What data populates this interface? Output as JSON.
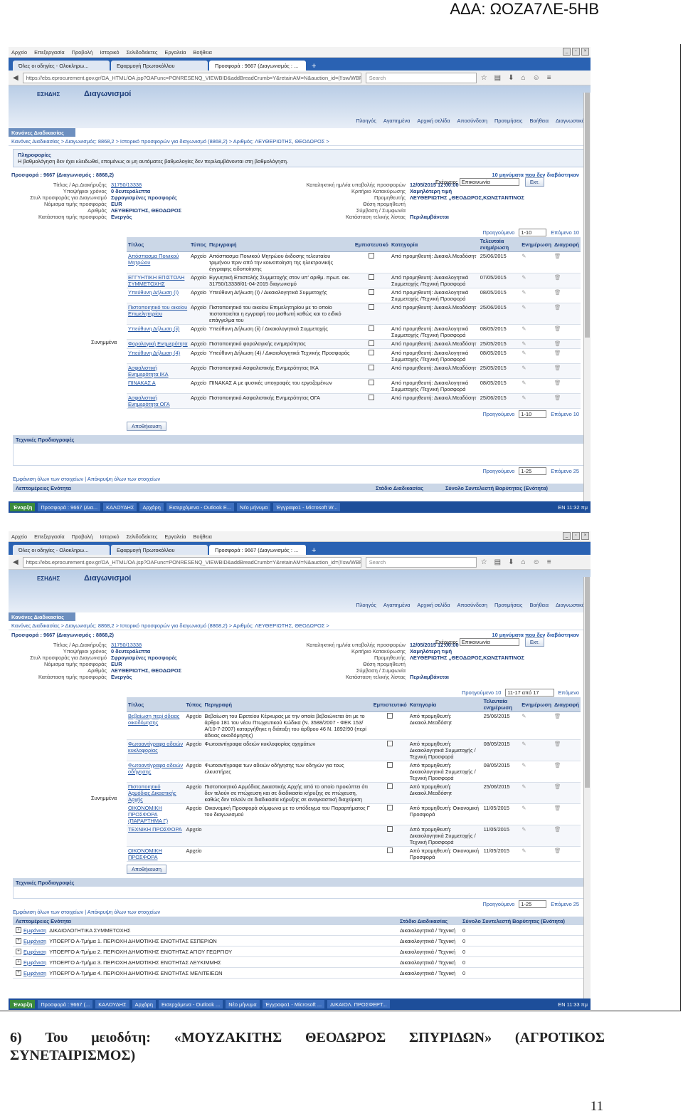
{
  "ada": "ΑΔΑ: ΩΟΖΑ7ΛΕ-5ΗΒ",
  "browser": {
    "menu": [
      "Αρχείο",
      "Επεξεργασία",
      "Προβολή",
      "Ιστορικό",
      "Σελιδοδείκτες",
      "Εργαλεία",
      "Βοήθεια"
    ],
    "tabs": [
      "Όλες οι οδηγίες - Ολοκληρω...",
      "Εφαρμογή Πρωτοκόλλου",
      "Προσφορά : 9667 (Διαγωνισμός : ..."
    ],
    "url": "https://ebs.eprocurement.gov.gr/OA_HTML/OA.jsp?OAFunc=PONRESENQ_VIEWBID&addBreadCrumb=Y&retainAM=N&auction_id=(!!sw/WBR0gKB",
    "search_placeholder": "Search"
  },
  "app": {
    "logo": "ΕΣΗΔΗΣ",
    "title": "Διαγωνισμοί",
    "menu": [
      "Πλοηγός",
      "Αγαπημένα",
      "Αρχική σελίδα",
      "Αποσύνδεση",
      "Προτιμήσεις",
      "Βοήθεια",
      "Διαγνωστικά"
    ],
    "tab_label": "Κανόνες Διαδικασίας",
    "breadcrumbs1": "Κανόνες Διαδικασίας > Διαγωνισμός: 8868,2 > Ιστορικό προσφορών για διαγωνισμό (8868,2) > Αριθμός: ΛΕΥΘΕΡΙΩΤΗΣ, ΘΕΟΔΩΡΟΣ >",
    "info_title": "Πληροφορίες",
    "info_text": "Η βαθμολόγηση δεν έχει κλειδωθεί, επομένως οι μη αυτόματες βαθμολογίες δεν περιλαμβάνονται στη βαθμολόγηση.",
    "offer_title": "Προσφορά : 9667 (Διαγωνισμός : 8868,2)",
    "unread": "10 μηνύματα που δεν διαβάστηκαν",
    "actions_label": "Ενέργειες",
    "actions_value": "Επικοινωνία",
    "go": "Εκτ.",
    "summary_left_labels": [
      "Τίτλος / Αρ.Διακήρυξης",
      "Υποψήφιοι χρόνος",
      "Στυλ προσφοράς για Διαγωνισμό",
      "Νόμισμα τιμής προσφοράς",
      "Αριθμός",
      "Κατάσταση τιμής προσφοράς"
    ],
    "summary_left_values1": [
      "31750/13338",
      "0 δευτερόλεπτα",
      "Σφραγισμένες προσφορές",
      "EUR",
      "ΛΕΥΘΕΡΙΩΤΗΣ, ΘΕΟΔΩΡΟΣ",
      "Ενεργός"
    ],
    "summary_right_labels": [
      "Καταληκτική ημ/νία υποβολής προσφορών",
      "Κριτήριο Κατακύρωσης",
      "Προμηθευτής",
      "Θέση προμηθευτή",
      "Σύμβαση / Συμφωνία",
      "Κατάσταση τελικής λίστας"
    ],
    "summary_right_values": [
      "12/05/2015 12:00:00",
      "Χαμηλότερη τιμή",
      "ΛΕΥΘΕΡΙΩΤΗΣ ,,ΘΕΟΔΩΡΟΣ,ΚΩΝΣΤΑΝΤΙΝΟΣ",
      "",
      "",
      "Περιλαμβάνεται"
    ],
    "attachments_label": "Συνημμένα",
    "table_headers": [
      "Τίτλος",
      "Τύπος",
      "Περιγραφή",
      "Εμπιστευτικό",
      "Κατηγορία",
      "Τελευταία ενημέρωση",
      "Ενημέρωση",
      "Διαγραφή"
    ],
    "prev": "Προηγούμενο",
    "next10": "Επόμενο 10",
    "range1": "1-10",
    "range25": "1-25",
    "next25": "Επόμενο 25",
    "download": "Αποθήκευση",
    "tech_specs": "Τεχνικές Προδιαγραφές",
    "show_all": "Εμφάνιση όλων των στοιχείων",
    "hide_all": "Απόκρυψη όλων των στοιχείων",
    "req_header": "Λεπτομέρειες Ενότητα",
    "stage": "Στάδιο Διαδικασίας",
    "total": "Σύνολο Συντελεστή Βαρύτητας (Ενότητα)"
  },
  "rows1": [
    {
      "title": "Απόσπασμα Ποινικού Μητρώου",
      "type": "Αρχείο",
      "desc": "Απόσπασμα Ποινικού Μητρώου έκδοσης τελευταίου τριμήνου πριν από την κοινοποίηση της ηλεκτρονικής έγγραφης ειδοποίησης",
      "cat": "Από προμηθευτή: Δικαιολ.Μεαδόσητ",
      "date": "25/06/2015"
    },
    {
      "title": "ΕΓΓΥΗΤΙΚΗ ΕΠΙΣΤΟΛΗ ΣΥΜΜΕΤΟΧΗΣ",
      "type": "Αρχείο",
      "desc": "Εγγυητική Επιστολής Συμμετοχής στον υπ' αριθμ. πρωτ. οικ. 31750/13338/01-04-2015 διαγωνισμό",
      "cat": "Από προμηθευτή: Δικαιολογητικά Συμμετοχής /Τεχνική Προσφορά",
      "date": "07/05/2015"
    },
    {
      "title": "Υπεύθυνη Δήλωση (Ι)",
      "type": "Αρχείο",
      "desc": "Υπεύθυνη Δήλωση (Ι) / Δικαιολογητικά Συμμετοχής",
      "cat": "Από προμηθευτή: Δικαιολογητικά Συμμετοχής /Τεχνική Προσφορά",
      "date": "08/05/2015"
    },
    {
      "title": "Πιστοποιητικό του οικείου Επιμελητηρίου",
      "type": "Αρχείο",
      "desc": "Πιστοποιητικό του οικείου Επιμελητηρίου με το οποίο πιστοποιείται η εγγραφή του μισθωτή καθώς και το ειδικό επάγγελμα του",
      "cat": "Από προμηθευτή: Δικαιολ.Μεαδόσητ",
      "date": "25/06/2015"
    },
    {
      "title": "Υπεύθυνη Δήλωση (ii)",
      "type": "Αρχείο",
      "desc": "Υπεύθυνη Δήλωση (ii) / Δικαιολογητικά Συμμετοχής",
      "cat": "Από προμηθευτή: Δικαιολογητικά Συμμετοχής /Τεχνική Προσφορά",
      "date": "08/05/2015"
    },
    {
      "title": "Φορολογική Ενημερότητα",
      "type": "Αρχείο",
      "desc": "Πιστοποιητικό φορολογικής ενημερότητας",
      "cat": "Από προμηθευτή: Δικαιολ.Μεαδόσητ",
      "date": "25/05/2015"
    },
    {
      "title": "Υπεύθυνη Δήλωση (4)",
      "type": "Αρχείο",
      "desc": "Υπεύθυνη Δήλωση (4) / Δικαιολογητικά Τεχνικής Προσφοράς",
      "cat": "Από προμηθευτή: Δικαιολογητικά Συμμετοχής /Τεχνική Προσφορά",
      "date": "08/05/2015"
    },
    {
      "title": "Ασφαλιστική Ενημερότητα ΙΚΑ",
      "type": "Αρχείο",
      "desc": "Πιστοποιητικό Ασφαλιστικής Ενημερότητας ΙΚΑ",
      "cat": "Από προμηθευτή: Δικαιολ.Μεαδόσητ",
      "date": "25/05/2015"
    },
    {
      "title": "ΠΙΝΑΚΑΣ Α",
      "type": "Αρχείο",
      "desc": "ΠΙΝΑΚΑΣ Α με φυσικές υπογραφές του εργαζομένων",
      "cat": "Από προμηθευτή: Δικαιολογητικά Συμμετοχής /Τεχνική Προσφορά",
      "date": "08/05/2015"
    },
    {
      "title": "Ασφαλιστική Ενημερότητα ΟΓΑ",
      "type": "Αρχείο",
      "desc": "Πιστοποιητικό Ασφαλιστικής Ενημερότητας ΟΓΑ",
      "cat": "Από προμηθευτή: Δικαιολ.Μεαδόσητ",
      "date": "25/06/2015"
    }
  ],
  "rows2": [
    {
      "title": "Βεβαίωση περί άδειας οικοδόμησης",
      "type": "Αρχείο",
      "desc": "Βεβαίωση του Εφετείου Κέρκυρας με την οποία βεβαιώνεται ότι με το άρθρο 181 του νέου Πτωχευτικού Κώδικα (Ν. 3588/2007 - ΦΕΚ 153/Α/10-7-2007) καταργήθηκε η διάταξη του άρθρου 46 Ν. 1892/90 (περί άδειας οικοδόμησης)",
      "cat": "Από προμηθευτή: Δικαιολ.Μεαδόσητ",
      "date": "25/06/2015"
    },
    {
      "title": "Φωτοαντίγραφα αδειών κυκλοφορίας",
      "type": "Αρχείο",
      "desc": "Φωτοαντίγραφα αδειών κυκλοφορίας οχημάτων",
      "cat": "Από προμηθευτή: Δικαιολογητικά Συμμετοχής /Τεχνική Προσφορά",
      "date": "08/05/2015"
    },
    {
      "title": "Φωτοαντίγραφα αδειών οδήγησης",
      "type": "Αρχείο",
      "desc": "Φωτοαντίγραφα των αδειών οδήγησης των οδηγών για τους ελκυστήρες",
      "cat": "Από προμηθευτή: Δικαιολογητικά Συμμετοχής /Τεχνική Προσφορά",
      "date": "08/05/2015"
    },
    {
      "title": "Πιστοποιητικό Αρμόδιας Δικαστικής Αρχής",
      "type": "Αρχείο",
      "desc": "Πιστοποιητικό Αρμόδιας Δικαστικής Αρχής από το οποίο προκύπτει ότι δεν τελούν σε πτώχευση και σε διαδικασία κήρυξης σε πτώχευση, καθώς δεν τελούν σε διαδικασία κήρυξης σε αναγκαστική διαχείριση",
      "cat": "Από προμηθευτή: Δικαιολ.Μεαδόσητ",
      "date": "25/06/2015"
    },
    {
      "title": "ΟΙΚΟΝΟΜΙΚΗ ΠΡΟΣΦΟΡΑ (ΠΑΡΑΡΤΗΜΑ Γ)",
      "type": "Αρχείο",
      "desc": "Οικονομική Προσφορά σύμφωνα με το υπόδειγμα του Παραρτήματος Γ του διαγωνισμού",
      "cat": "Από προμηθευτή: Οικονομική Προσφορά",
      "date": "11/05/2015"
    },
    {
      "title": "ΤΕΧΝΙΚΗ ΠΡΟΣΦΟΡΑ",
      "type": "Αρχείο",
      "desc": "",
      "cat": "Από προμηθευτή: Δικαιολογητικά Συμμετοχής /Τεχνική Προσφορά",
      "date": "11/05/2015"
    },
    {
      "title": "ΟΙΚΟΝΟΜΙΚΗ ΠΡΟΣΦΟΡΑ",
      "type": "Αρχείο",
      "desc": "",
      "cat": "Από προμηθευτή: Οικονομική Προσφορά",
      "date": "11/05/2015"
    }
  ],
  "shot2": {
    "range": "11-17 από 17",
    "prev10": "Προηγούμενο 10",
    "next": "Επόμενο"
  },
  "req_rows": [
    {
      "item": "ΔΙΚΑΙΟΛΟΓΗΤΙΚΑ ΣΥΜΜΕΤΟΧΗΣ",
      "stage": "Δικαιολογητικά / Τεχνική",
      "total": "0"
    },
    {
      "item": "ΥΠΟΕΡΓΟ Α-Τμήμα 1. ΠΕΡΙΟΧΗ ΔΗΜΟΤΙΚΗΣ ΕΝΟΤΗΤΑΣ ΕΣΠΕΡΙΩΝ",
      "stage": "Δικαιολογητικά / Τεχνική",
      "total": "0"
    },
    {
      "item": "ΥΠΟΕΡΓΟ Α-Τμήμα 2. ΠΕΡΙΟΧΗ ΔΗΜΟΤΙΚΗΣ ΕΝΟΤΗΤΑΣ ΑΓΙΟΥ ΓΕΩΡΓΙΟΥ",
      "stage": "Δικαιολογητικά / Τεχνική",
      "total": "0"
    },
    {
      "item": "ΥΠΟΕΡΓΟ Α-Τμήμα 3. ΠΕΡΙΟΧΗ ΔΗΜΟΤΙΚΗΣ ΕΝΟΤΗΤΑΣ ΛΕΥΚΙΜΜΗΣ",
      "stage": "Δικαιολογητικά / Τεχνική",
      "total": "0"
    },
    {
      "item": "ΥΠΟΕΡΓΟ Α-Τμήμα 4. ΠΕΡΙΟΧΗ ΔΗΜΟΤΙΚΗΣ ΕΝΟΤΗΤΑΣ ΜΕΛΙΤΕΙΕΩΝ",
      "stage": "Δικαιολογητικά / Τεχνική",
      "total": "0"
    }
  ],
  "req_expand": "Εμφάνιση",
  "taskbar1": [
    "Έναρξη",
    "Προσφορά : 9667 (Δια...",
    "ΚΑΛΟΥΔΗΣ",
    "Αρχάρη",
    "Εισερχόμενα - Outlook E...",
    "Νέο μήνυμα",
    "Έγγραφο1 - Microsoft W..."
  ],
  "taskbar2": [
    "Έναρξη",
    "Προσφορά : 9667 (...",
    "ΚΑΛΟΥΔΗΣ",
    "Αρχάρη",
    "Εισερχόμενα - Outlook ...",
    "Νέο μήνυμα",
    "Έγγραφο1 - Microsoft ...",
    "ΔΙΚΑΙΟΛ. ΠΡΟΣΦΕΡΤ..."
  ],
  "lang": "EN",
  "time1": "11:32 πμ",
  "time2": "11:33 πμ",
  "caption": {
    "w1": "6)",
    "w2": "Του",
    "w3": "μειοδότη:",
    "w4": "«ΜΟΥΖΑΚΙΤΗΣ",
    "w5": "ΘΕΟΔΩΡΟΣ",
    "w6": "ΣΠΥΡΙΔΩΝ»",
    "w7": "(ΑΓΡΟΤΙΚΟΣ",
    "line2": "ΣΥΝΕΤΑΙΡΙΣΜΟΣ)"
  },
  "page_number": "11"
}
